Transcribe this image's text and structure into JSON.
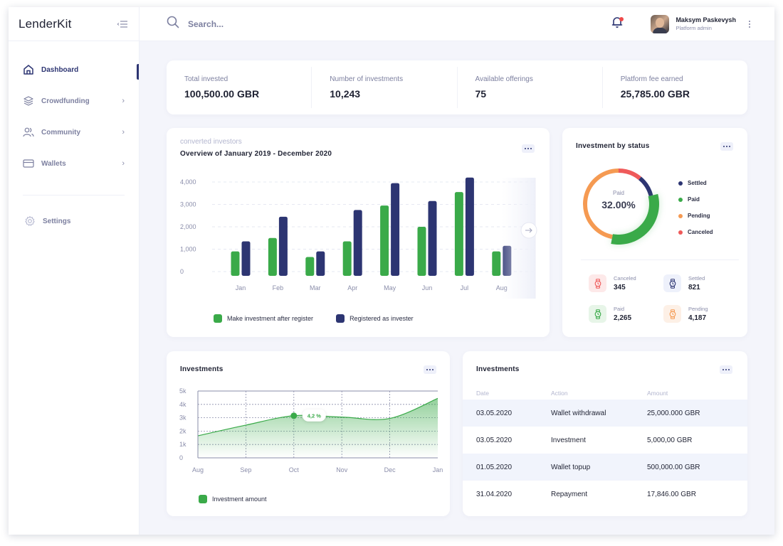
{
  "app": {
    "logo": "LenderKit"
  },
  "sidebar": {
    "items": [
      {
        "label": "Dashboard",
        "icon": "home-icon",
        "active": true,
        "has_children": false
      },
      {
        "label": "Crowdfunding",
        "icon": "layers-icon",
        "active": false,
        "has_children": true
      },
      {
        "label": "Community",
        "icon": "users-icon",
        "active": false,
        "has_children": true
      },
      {
        "label": "Wallets",
        "icon": "wallet-card-icon",
        "active": false,
        "has_children": true
      }
    ],
    "settings": {
      "label": "Settings",
      "icon": "gear-icon"
    }
  },
  "topbar": {
    "search_placeholder": "Search...",
    "notifications": {
      "icon": "bell-icon",
      "has_unread": true
    },
    "user": {
      "name": "Maksym Paskevysh",
      "role": "Platform admin"
    }
  },
  "stats": [
    {
      "label": "Total invested",
      "value": "100,500.00 GBR"
    },
    {
      "label": "Number of investments",
      "value": "10,243"
    },
    {
      "label": "Available offerings",
      "value": "75"
    },
    {
      "label": "Platform fee earned",
      "value": "25,785.00 GBR"
    }
  ],
  "colors": {
    "primary": "#2d3572",
    "green": "#3aaa49",
    "orange": "#f59a52",
    "red": "#ef5a5a",
    "background": "#f4f5fb"
  },
  "chart_data": [
    {
      "type": "bar",
      "subtitle": "converted investors",
      "title": "Overview of January 2019 - December 2020",
      "categories": [
        "Jan",
        "Feb",
        "Mar",
        "Apr",
        "May",
        "Jun",
        "Jul",
        "Aug"
      ],
      "series": [
        {
          "name": "Make investment after register",
          "color": "#3aaa49",
          "values": [
            900,
            1500,
            650,
            1350,
            2950,
            2000,
            3550,
            900
          ]
        },
        {
          "name": "Registered as invester",
          "color": "#2d3572",
          "values": [
            1350,
            2450,
            900,
            2750,
            3950,
            3150,
            4200,
            1150
          ]
        }
      ],
      "yticks": [
        "0",
        "1,000",
        "2,000",
        "3,000",
        "4,000"
      ],
      "ylim": [
        0,
        4000
      ],
      "grid": true,
      "legend": "bottom-left"
    },
    {
      "type": "pie",
      "title": "Investment by status",
      "center_label": "Paid",
      "center_value": "32.00%",
      "slices": [
        {
          "name": "Settled",
          "value": 10,
          "color": "#2d3572"
        },
        {
          "name": "Paid",
          "value": 32,
          "color": "#3aaa49"
        },
        {
          "name": "Pending",
          "value": 47,
          "color": "#f59a52"
        },
        {
          "name": "Canceled",
          "value": 11,
          "color": "#ef5a5a"
        }
      ],
      "legend": "right"
    },
    {
      "type": "area",
      "title": "Investments",
      "x": [
        "Aug",
        "Sep",
        "Oct",
        "Nov",
        "Dec",
        "Jan"
      ],
      "values": [
        1650,
        2450,
        3150,
        3050,
        2950,
        4450
      ],
      "yticks": [
        "0",
        "1k",
        "2k",
        "3k",
        "4k",
        "5k"
      ],
      "ylim": [
        0,
        5000
      ],
      "highlight": {
        "x": "Oct",
        "label": "4,2 %"
      },
      "series_name": "Investment amount",
      "color": "#3aaa49",
      "grid": true,
      "legend": "bottom-left"
    }
  ],
  "status_summary": [
    {
      "label": "Canceled",
      "value": "345",
      "color": "#ef5a5a",
      "bg": "#fde9e9"
    },
    {
      "label": "Settled",
      "value": "821",
      "color": "#2d3572",
      "bg": "#eef1fb"
    },
    {
      "label": "Paid",
      "value": "2,265",
      "color": "#3aaa49",
      "bg": "#e7f5e8"
    },
    {
      "label": "Pending",
      "value": "4,187",
      "color": "#f59a52",
      "bg": "#fdf0e6"
    }
  ],
  "table": {
    "title": "Investments",
    "columns": [
      "Date",
      "Action",
      "Amount"
    ],
    "rows": [
      [
        "03.05.2020",
        "Wallet withdrawal",
        "25,000.000 GBR"
      ],
      [
        "03.05.2020",
        "Investment",
        "5,000,00 GBR"
      ],
      [
        "01.05.2020",
        "Wallet topup",
        "500,000.00 GBR"
      ],
      [
        "31.04.2020",
        "Repayment",
        "17,846.00 GBR"
      ]
    ]
  }
}
